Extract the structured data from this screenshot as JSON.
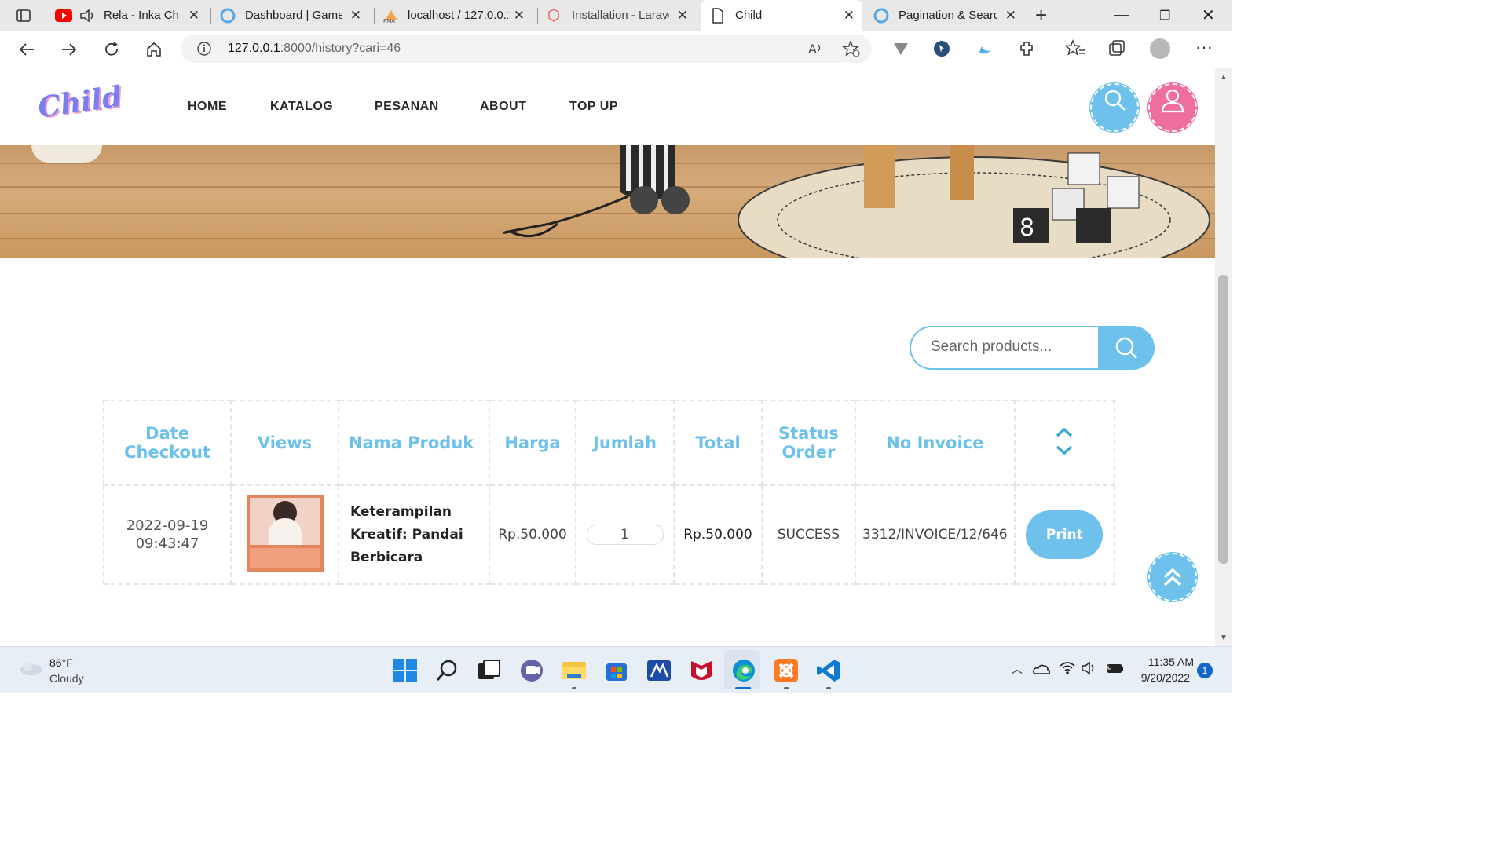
{
  "browser": {
    "tabs": [
      {
        "label": "Rela - Inka Chr",
        "icon": "youtube-icon"
      },
      {
        "label": "Dashboard | Gamel",
        "icon": "site-icon"
      },
      {
        "label": "localhost / 127.0.0.1",
        "icon": "phpmyadmin-icon"
      },
      {
        "label": "Installation - Larave",
        "icon": "laravel-icon"
      },
      {
        "label": "Child",
        "icon": "page-icon",
        "active": true
      },
      {
        "label": "Pagination & Searc",
        "icon": "site-icon"
      }
    ],
    "url": "127.0.0.1:8000/history?cari=46",
    "url_host": "127.0.0.1",
    "url_rest": ":8000/history?cari=46"
  },
  "site": {
    "logo": "Child",
    "nav": [
      "HOME",
      "KATALOG",
      "PESANAN",
      "ABOUT",
      "TOP UP"
    ]
  },
  "search": {
    "placeholder": "Search products..."
  },
  "table": {
    "headers": [
      "Date Checkout",
      "Views",
      "Nama Produk",
      "Harga",
      "Jumlah",
      "Total",
      "Status Order",
      "No Invoice"
    ],
    "rows": [
      {
        "date": "2022-09-19",
        "time": "09:43:47",
        "product": "Keterampilan Kreatif: Pandai Berbicara",
        "harga": "Rp.50.000",
        "jumlah": "1",
        "total": "Rp.50.000",
        "status": "SUCCESS",
        "invoice": "3312/INVOICE/12/646",
        "action": "Print"
      }
    ]
  },
  "taskbar": {
    "weather_temp": "86°F",
    "weather_desc": "Cloudy",
    "time": "11:35 AM",
    "date": "9/20/2022",
    "notifications": "1"
  },
  "colors": {
    "accent": "#6ec1ea",
    "pink": "#ee6f9f",
    "logo": "#7b7ef0"
  }
}
